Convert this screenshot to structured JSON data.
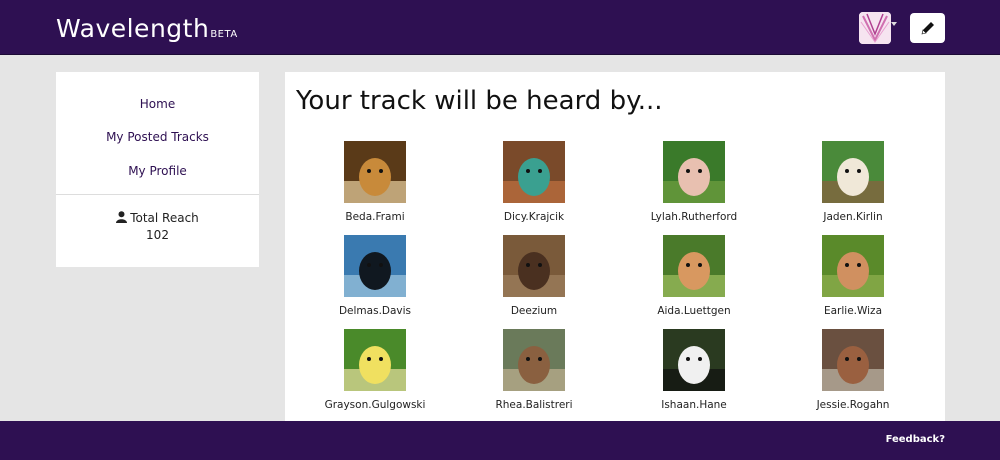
{
  "header": {
    "logo": "Wavelength",
    "logo_badge": "BETA",
    "avatar_icon": "user-avatar-icon",
    "compose_icon": "pencil-icon",
    "brand_color": "#2e1052"
  },
  "sidebar": {
    "items": [
      {
        "label": "Home"
      },
      {
        "label": "My Posted Tracks"
      },
      {
        "label": "My Profile"
      }
    ],
    "reach_icon": "person-icon",
    "reach_label": "Total Reach",
    "reach_value": "102"
  },
  "main": {
    "title": "Your track will be heard by...",
    "listeners": [
      {
        "name": "Beda.Frami",
        "colors": [
          "#5a3a18",
          "#c88a3a",
          "#e8d0a0"
        ]
      },
      {
        "name": "Dicy.Krajcik",
        "colors": [
          "#7a4a2a",
          "#3aa090",
          "#c07040"
        ]
      },
      {
        "name": "Lylah.Rutherford",
        "colors": [
          "#3a7a2a",
          "#e8c0b0",
          "#70a040"
        ]
      },
      {
        "name": "Jaden.Kirlin",
        "colors": [
          "#4a8a3a",
          "#f0e8d8",
          "#8a6040"
        ]
      },
      {
        "name": "Delmas.Davis",
        "colors": [
          "#3a7ab0",
          "#101820",
          "#a0c8e0"
        ]
      },
      {
        "name": "Deezium",
        "colors": [
          "#7a5a3a",
          "#4a3020",
          "#a08060"
        ]
      },
      {
        "name": "Aida.Luettgen",
        "colors": [
          "#4a7a2a",
          "#d89860",
          "#a0c060"
        ]
      },
      {
        "name": "Earlie.Wiza",
        "colors": [
          "#5a8a2a",
          "#d09060",
          "#90b050"
        ]
      },
      {
        "name": "Grayson.Gulgowski",
        "colors": [
          "#4a8a2a",
          "#f0e060",
          "#e8e0a0"
        ]
      },
      {
        "name": "Rhea.Balistreri",
        "colors": [
          "#6a7a5a",
          "#8a6040",
          "#c0b090"
        ]
      },
      {
        "name": "Ishaan.Hane",
        "colors": [
          "#2a3a20",
          "#f0f0f0",
          "#101010"
        ]
      },
      {
        "name": "Jessie.Rogahn",
        "colors": [
          "#6a5040",
          "#9a6040",
          "#c0b8a8"
        ]
      }
    ]
  },
  "footer": {
    "feedback": "Feedback?"
  }
}
